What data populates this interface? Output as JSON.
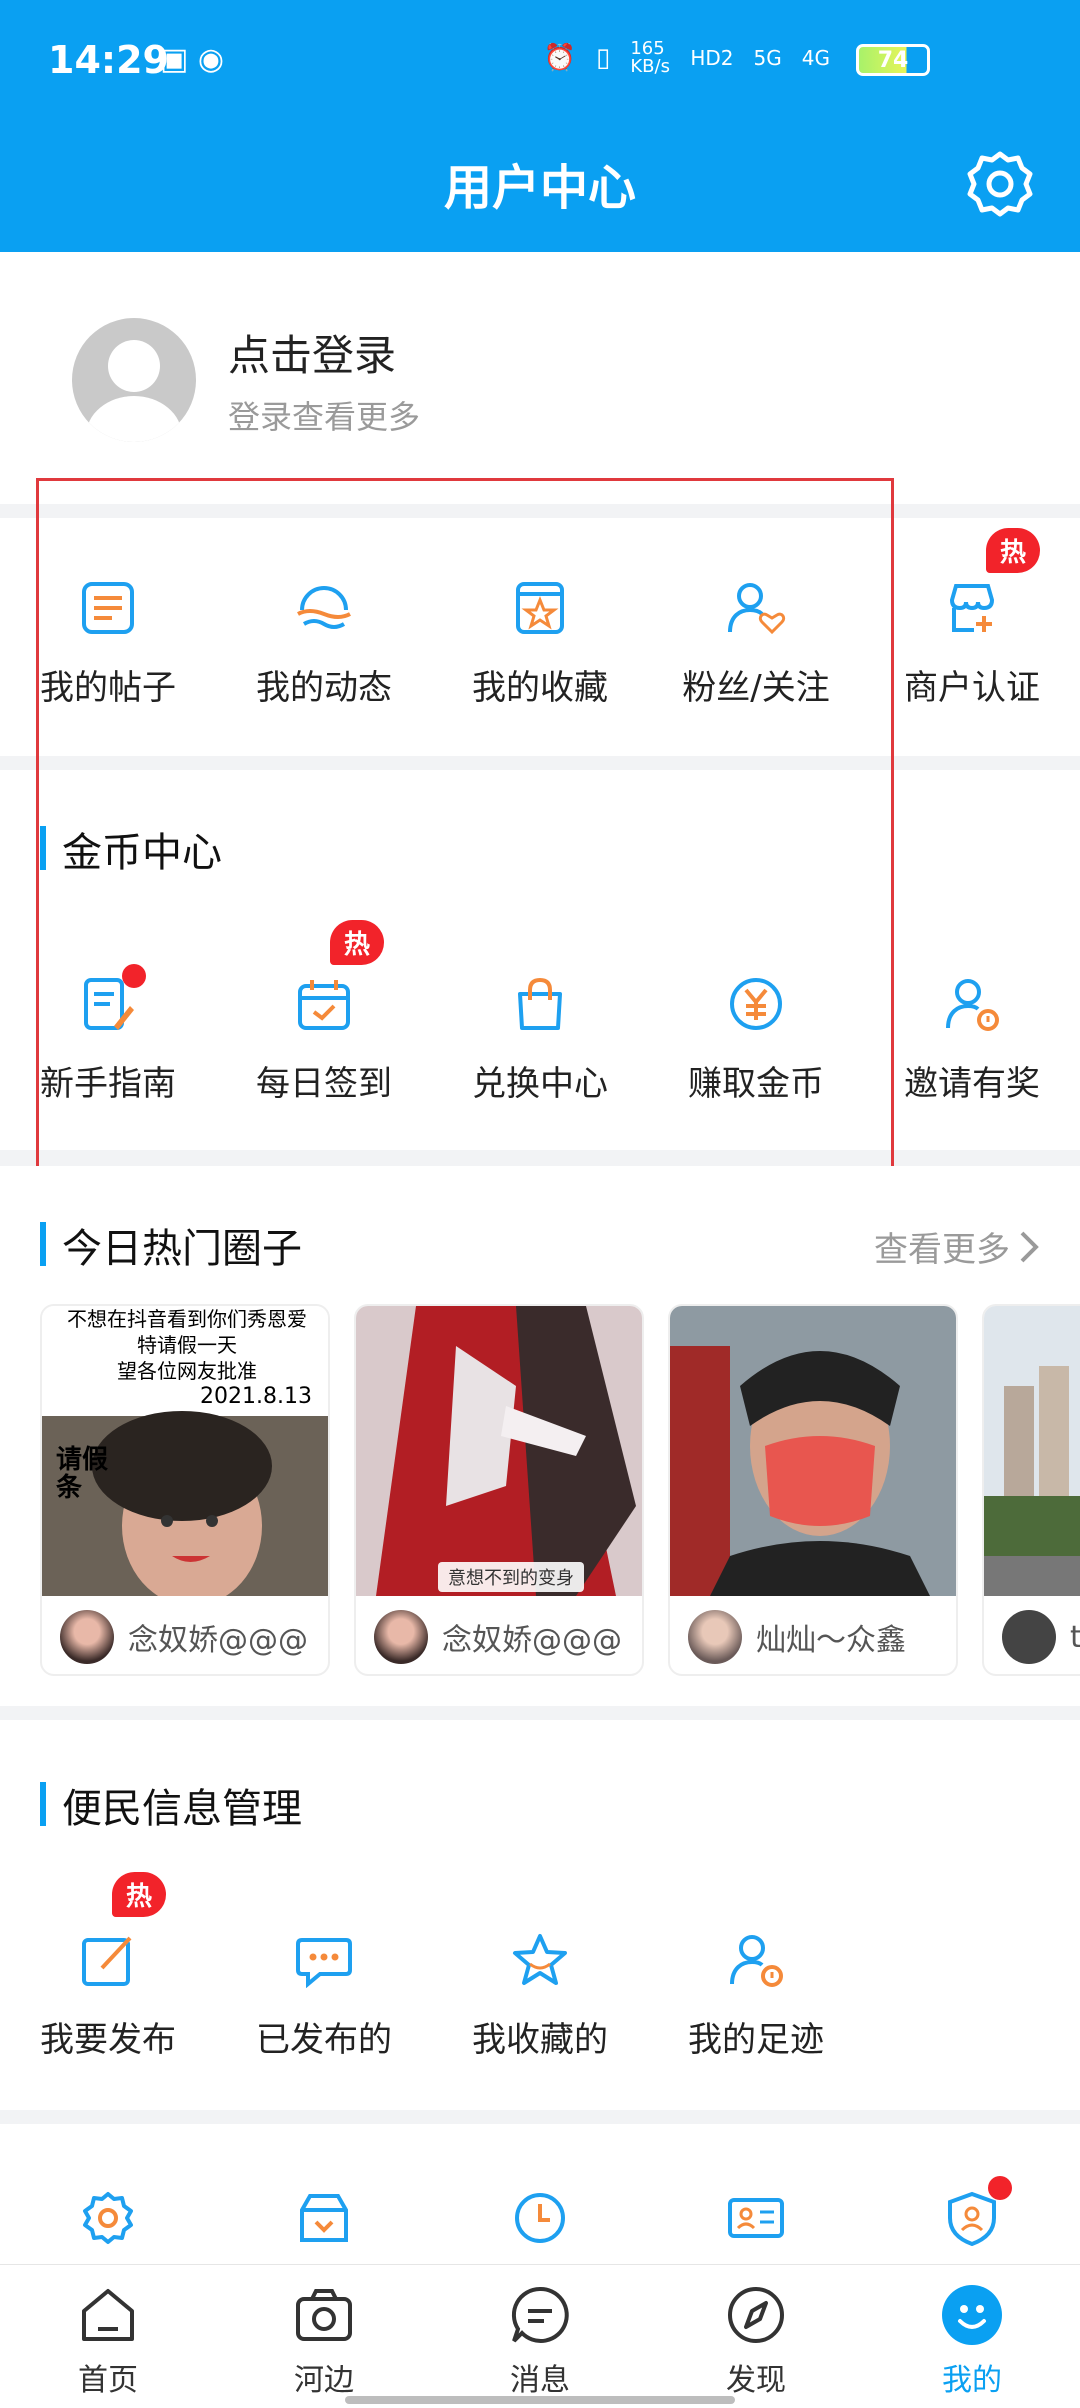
{
  "status_bar": {
    "time": "14:29",
    "speed": "165 KB/s",
    "network1": "HD2",
    "network2": "5G",
    "network3": "4G",
    "battery": "74"
  },
  "header": {
    "title": "用户中心"
  },
  "login": {
    "title": "点击登录",
    "subtitle": "登录查看更多"
  },
  "quick_menu": {
    "items": [
      {
        "label": "我的帖子",
        "icon": "post-icon"
      },
      {
        "label": "我的动态",
        "icon": "activity-icon"
      },
      {
        "label": "我的收藏",
        "icon": "favorite-icon"
      },
      {
        "label": "粉丝/关注",
        "icon": "fans-icon"
      },
      {
        "label": "商户认证",
        "icon": "shop-cert-icon",
        "badge": "热"
      }
    ]
  },
  "coin_center": {
    "title": "金币中心",
    "items": [
      {
        "label": "新手指南",
        "icon": "guide-icon"
      },
      {
        "label": "每日签到",
        "icon": "checkin-icon",
        "badge": "热"
      },
      {
        "label": "兑换中心",
        "icon": "exchange-icon"
      },
      {
        "label": "赚取金币",
        "icon": "coin-icon"
      },
      {
        "label": "邀请有奖",
        "icon": "invite-icon"
      }
    ]
  },
  "hot_circles": {
    "title": "今日热门圈子",
    "more": "查看更多",
    "cards": [
      {
        "name": "念奴娇@@@",
        "text_lines": [
          "不想在抖音看到你们秀恩爱",
          "特请假一天",
          "望各位网友批准",
          "2021.8.13"
        ],
        "sticker": "请假条"
      },
      {
        "name": "念奴娇@@@",
        "caption": "意想不到的变身"
      },
      {
        "name": "灿灿～众鑫"
      },
      {
        "name": "t"
      }
    ]
  },
  "convenience": {
    "title": "便民信息管理",
    "items": [
      {
        "label": "我要发布",
        "icon": "publish-icon",
        "badge": "热"
      },
      {
        "label": "已发布的",
        "icon": "published-icon"
      },
      {
        "label": "我收藏的",
        "icon": "star-icon"
      },
      {
        "label": "我的足迹",
        "icon": "footprint-icon"
      }
    ]
  },
  "tools_row": [
    "settings-icon",
    "download-box-icon",
    "clock-icon",
    "id-card-icon",
    "shield-user-icon"
  ],
  "bottom_nav": {
    "items": [
      {
        "label": "首页",
        "icon": "home-icon"
      },
      {
        "label": "河边",
        "icon": "camera-icon"
      },
      {
        "label": "消息",
        "icon": "message-icon"
      },
      {
        "label": "发现",
        "icon": "compass-icon"
      },
      {
        "label": "我的",
        "icon": "profile-icon",
        "active": true
      }
    ]
  },
  "colors": {
    "primary": "#0aa0f2",
    "hot": "#f2232a",
    "icon_orange": "#f58a3a"
  }
}
